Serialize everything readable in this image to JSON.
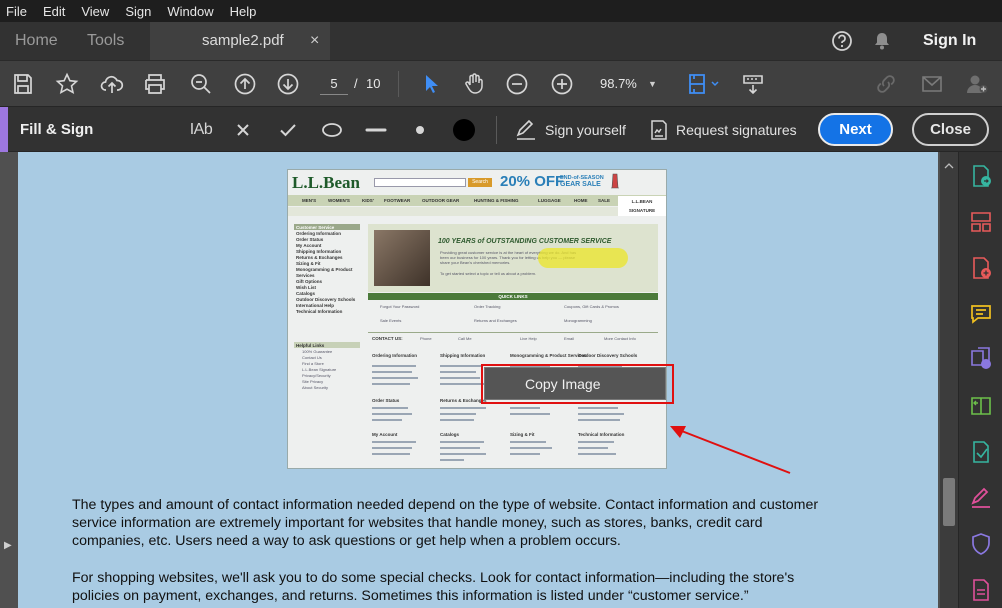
{
  "menubar": {
    "items": [
      "File",
      "Edit",
      "View",
      "Sign",
      "Window",
      "Help"
    ]
  },
  "tabs": {
    "home": "Home",
    "tools": "Tools",
    "document": "sample2.pdf",
    "close_glyph": "×",
    "signin": "Sign In"
  },
  "toolbar": {
    "page_current": "5",
    "page_sep": "/",
    "page_total": "10",
    "zoom": "98.7%"
  },
  "fill_sign": {
    "title": "Fill & Sign",
    "text_tool": "IAb",
    "sign_yourself": "Sign yourself",
    "request_signatures": "Request signatures",
    "next": "Next",
    "close": "Close"
  },
  "screenshot": {
    "logo": "L.L.Bean",
    "search_btn": "Search",
    "promo": "20% OFF",
    "promo_sub1": "END-of-SEASON",
    "promo_sub2": "GEAR SALE",
    "nav": [
      "MEN'S",
      "WOMEN'S",
      "KIDS'",
      "FOOTWEAR",
      "OUTDOOR GEAR",
      "HUNTING & FISHING",
      "LUGGAGE",
      "HOME",
      "SALE"
    ],
    "signature": "L.L.BEAN SIGNATURE",
    "banner_title": "100 YEARS of OUTSTANDING CUSTOMER SERVICE",
    "banner_text1": "Providing great customer service is at the heart of everything we do. And has",
    "banner_text2": "been our business for 100 years. Thank you for letting us help you — please",
    "banner_text3": "share your Bean's cherished memories.",
    "banner_text4": "To get started select a topic or tell us about a problem.",
    "quick_links": "QUICK LINKS",
    "quick_items": [
      "Forgot Your Password",
      "Order Tracking",
      "Coupons, Gift Cards & Promos",
      "Sale Events",
      "Returns and Exchanges",
      "Monogramming"
    ],
    "contact_us": "CONTACT US:",
    "contact_items": [
      "Phone",
      "Call Me",
      "Live Help",
      "Email",
      "More Contact Info"
    ],
    "sidebar": [
      "Customer Service",
      "Ordering Information",
      "Order Status",
      "My Account",
      "Shipping Information",
      "Returns & Exchanges",
      "Sizing & Fit",
      "Monogramming & Product",
      "Services",
      "Gift Options",
      "Wish List",
      "Catalogs",
      "Outdoor Discovery Schools",
      "International Help",
      "Technical Information"
    ],
    "sidebar2": [
      "Helpful Links",
      "100% Guarantee",
      "Contact Us",
      "Find a Store",
      "L.L.Bean Signature",
      "Privacy/Security",
      "Site Privacy",
      "About Security"
    ],
    "col_heads": [
      "Ordering Information",
      "Shipping Information",
      "Monogramming & Product Services",
      "Outdoor Discovery Schools",
      "Order Status",
      "Returns & Exchanges",
      "Sizing & Fit",
      "My Account",
      "Catalogs",
      "Technical Information"
    ]
  },
  "context_menu": {
    "copy_image": "Copy Image"
  },
  "body_text": {
    "p1_l1": "The types and amount of contact information needed depend on the type of website.  Contact information and customer",
    "p1_l2": "service information are extremely important for websites that handle money, such as stores, banks, credit card",
    "p1_l3": "companies, etc.  Users need a way to ask questions or get help when a problem occurs.",
    "p2_l1": "For shopping websites, we'll ask you to do some special checks.  Look for contact information—including the store's",
    "p2_l2": "policies on payment, exchanges, and returns.  Sometimes this information is listed under “customer service.”"
  },
  "colors": {
    "accent_purple": "#9d77e0",
    "next_blue": "#1473e6",
    "page_blue": "#a9cbe3",
    "annotation_red": "#e01010"
  }
}
